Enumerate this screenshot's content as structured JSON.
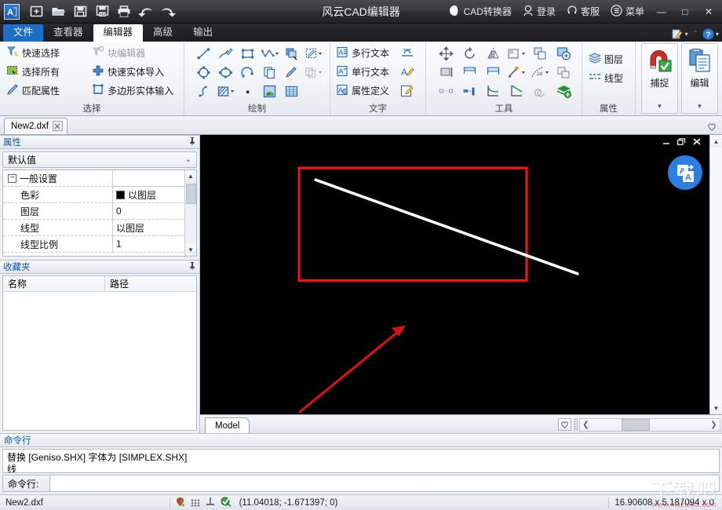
{
  "titlebar": {
    "app_title": "风云CAD编辑器",
    "logo_text": "A",
    "quick_access": [
      {
        "name": "new-file-icon",
        "label": "新建"
      },
      {
        "name": "open-file-icon",
        "label": "打开"
      },
      {
        "name": "save-icon",
        "label": "保存"
      },
      {
        "name": "save-pdf-icon",
        "label": "另存为PDF"
      },
      {
        "name": "print-icon",
        "label": "打印"
      },
      {
        "name": "undo-icon",
        "label": "撤销"
      },
      {
        "name": "redo-icon",
        "label": "重做"
      }
    ],
    "right_items": [
      {
        "name": "cad-converter",
        "label": "CAD转换器",
        "icon": "converter-icon"
      },
      {
        "name": "login",
        "label": "登录",
        "icon": "user-icon"
      },
      {
        "name": "support",
        "label": "客服",
        "icon": "headset-icon"
      },
      {
        "name": "menu",
        "label": "菜单",
        "icon": "list-menu-icon"
      }
    ],
    "window_buttons": {
      "minimize": "—",
      "maximize": "□",
      "close": "✕"
    }
  },
  "ribbon_tabs": [
    {
      "label": "文件",
      "style": "file"
    },
    {
      "label": "查看器",
      "style": "normal"
    },
    {
      "label": "编辑器",
      "style": "active"
    },
    {
      "label": "高级",
      "style": "normal"
    },
    {
      "label": "输出",
      "style": "normal"
    }
  ],
  "ribbon": {
    "groups": [
      {
        "title": "选择",
        "rows": [
          {
            "left": "快速选择",
            "right": "块编辑器",
            "right_dim": true
          },
          {
            "left": "选择所有",
            "right": "快速实体导入",
            "right_dim": false
          },
          {
            "left": "匹配属性",
            "right": "多边形实体输入",
            "right_dim": false
          }
        ]
      },
      {
        "title": "绘制"
      },
      {
        "title": "文字",
        "rows": [
          {
            "left": "多行文本"
          },
          {
            "left": "单行文本"
          },
          {
            "left": "属性定义"
          }
        ]
      },
      {
        "title": "工具"
      },
      {
        "title": "属性",
        "rows": [
          {
            "left": "图层"
          },
          {
            "left": "线型"
          }
        ]
      }
    ],
    "big_buttons": [
      {
        "caption": "捕捉",
        "icon": "snap-magnet-icon"
      },
      {
        "caption": "编辑",
        "icon": "edit-copy-icon"
      }
    ],
    "corner_icons": [
      "customize-icon",
      "collapse-ribbon-icon",
      "help-icon"
    ]
  },
  "file_tabs": {
    "tabs": [
      {
        "label": "New2.dxf",
        "close": "✕",
        "active": true
      }
    ],
    "favorite_icon": "heart-icon"
  },
  "left_dock": {
    "properties": {
      "title": "属性",
      "pin": "📌",
      "selector_value": "默认值",
      "group_label": "一般设置",
      "rows": [
        {
          "key": "色彩",
          "value": "以图层",
          "swatch": "#000000"
        },
        {
          "key": "图层",
          "value": "0",
          "swatch": null
        },
        {
          "key": "线型",
          "value": "以图层",
          "swatch": null
        },
        {
          "key": "线型比例",
          "value": "1",
          "swatch": null
        }
      ]
    },
    "favorites": {
      "title": "收藏夹",
      "pin": "📌",
      "columns": [
        "名称",
        "路径"
      ],
      "rows": []
    }
  },
  "canvas": {
    "background": "#000000",
    "window_controls": [
      "—",
      "❐",
      "✕"
    ],
    "translate_button": {
      "name": "translate-button",
      "label": "A"
    },
    "shapes": {
      "rectangle_color": "#e01b1b",
      "line_color": "#ffffff",
      "arrow_color": "#d41414"
    },
    "model_tab": "Model",
    "favorite_icon": "♡"
  },
  "command": {
    "title": "命令行",
    "log_lines": [
      "替换 [Geniso.SHX] 字体为 [SIMPLEX.SHX]",
      "线"
    ],
    "input_label": "命令行:",
    "input_value": "",
    "input_placeholder": ""
  },
  "status": {
    "filename": "New2.dxf",
    "icons": [
      "osnap-icon",
      "grid-icon",
      "ortho-icon",
      "snap-check-icon"
    ],
    "coordinates": "(11.04018; -1.671397; 0)",
    "dimensions": "16.90608 x 5.187094 x 0"
  },
  "watermark": {
    "line1": "下载吧",
    "line2": "www.xiazaiba.com"
  }
}
